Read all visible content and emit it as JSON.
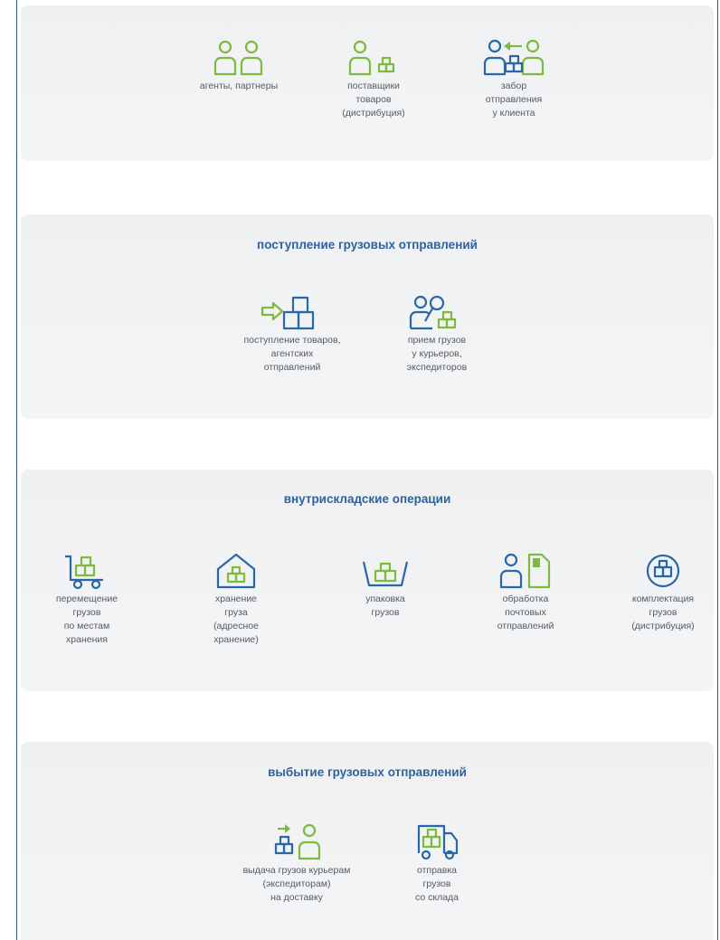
{
  "top": {
    "items": [
      {
        "label": "агенты, партнеры",
        "icon": "two-persons-icon"
      },
      {
        "label": "поставщики\nтоваров\n(дистрибуция)",
        "icon": "person-boxes-icon"
      },
      {
        "label": "забор\nотправления\nу клиента",
        "icon": "pickup-exchange-icon"
      }
    ]
  },
  "receiving": {
    "title": "поступление грузовых отправлений",
    "items": [
      {
        "label": "поступление товаров,\nагентских\nотправлений",
        "icon": "arrow-into-boxes-icon"
      },
      {
        "label": "прием грузов\nу курьеров,\nэкспедиторов",
        "icon": "courier-boxes-icon"
      }
    ]
  },
  "warehouse": {
    "title": "внутрискладские операции",
    "items": [
      {
        "label": "перемещение\nгрузов\nпо местам\nхранения",
        "icon": "hand-truck-icon"
      },
      {
        "label": "хранение\nгруза\n(адресное\nхранение)",
        "icon": "house-box-icon"
      },
      {
        "label": "упаковка\nгрузов",
        "icon": "box-in-tray-icon"
      },
      {
        "label": "обработка\nпочтовых\nотправлений",
        "icon": "person-document-icon"
      },
      {
        "label": "комплектация\nгрузов\n(дистрибуция)",
        "icon": "boxes-in-circle-icon"
      }
    ]
  },
  "dispatch": {
    "title": "выбытие грузовых отправлений",
    "items": [
      {
        "label": "выдача грузов курьерам\n(экспедиторам)\nна доставку",
        "icon": "handover-to-courier-icon"
      },
      {
        "label": "отправка\nгрузов\nсо склада",
        "icon": "delivery-truck-icon"
      }
    ]
  },
  "colors": {
    "green": "#7dba3e",
    "blue": "#2a67a8",
    "title": "#2e62a0",
    "text": "#555b62"
  }
}
